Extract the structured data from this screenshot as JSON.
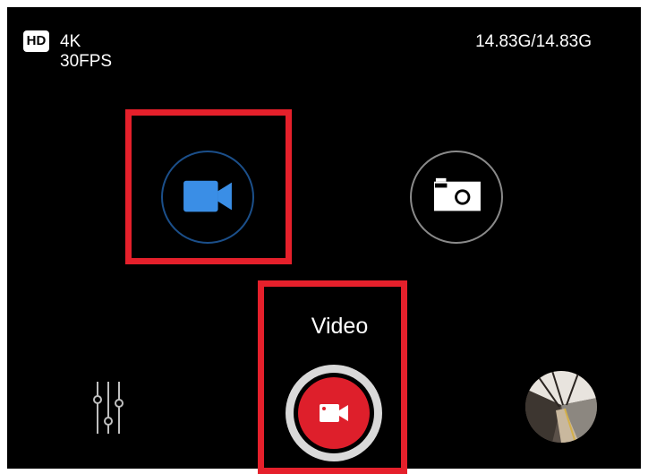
{
  "status_bar": {
    "hd_badge": "HD",
    "resolution": "4K 30FPS",
    "storage": "14.83G/14.83G"
  },
  "modes": [
    {
      "name": "video",
      "icon": "video-camera-icon",
      "selected": true,
      "color": "#3a8ee6"
    },
    {
      "name": "photo",
      "icon": "camera-icon",
      "selected": false,
      "color": "#ffffff"
    }
  ],
  "current_mode_label": "Video",
  "controls": {
    "settings_icon": "sliders-icon",
    "shutter_icon": "record-video-icon",
    "gallery_icon": "gallery-thumbnail"
  },
  "colors": {
    "highlight": "#e5202b",
    "accent": "#3a8ee6",
    "record": "#de1f2b"
  }
}
